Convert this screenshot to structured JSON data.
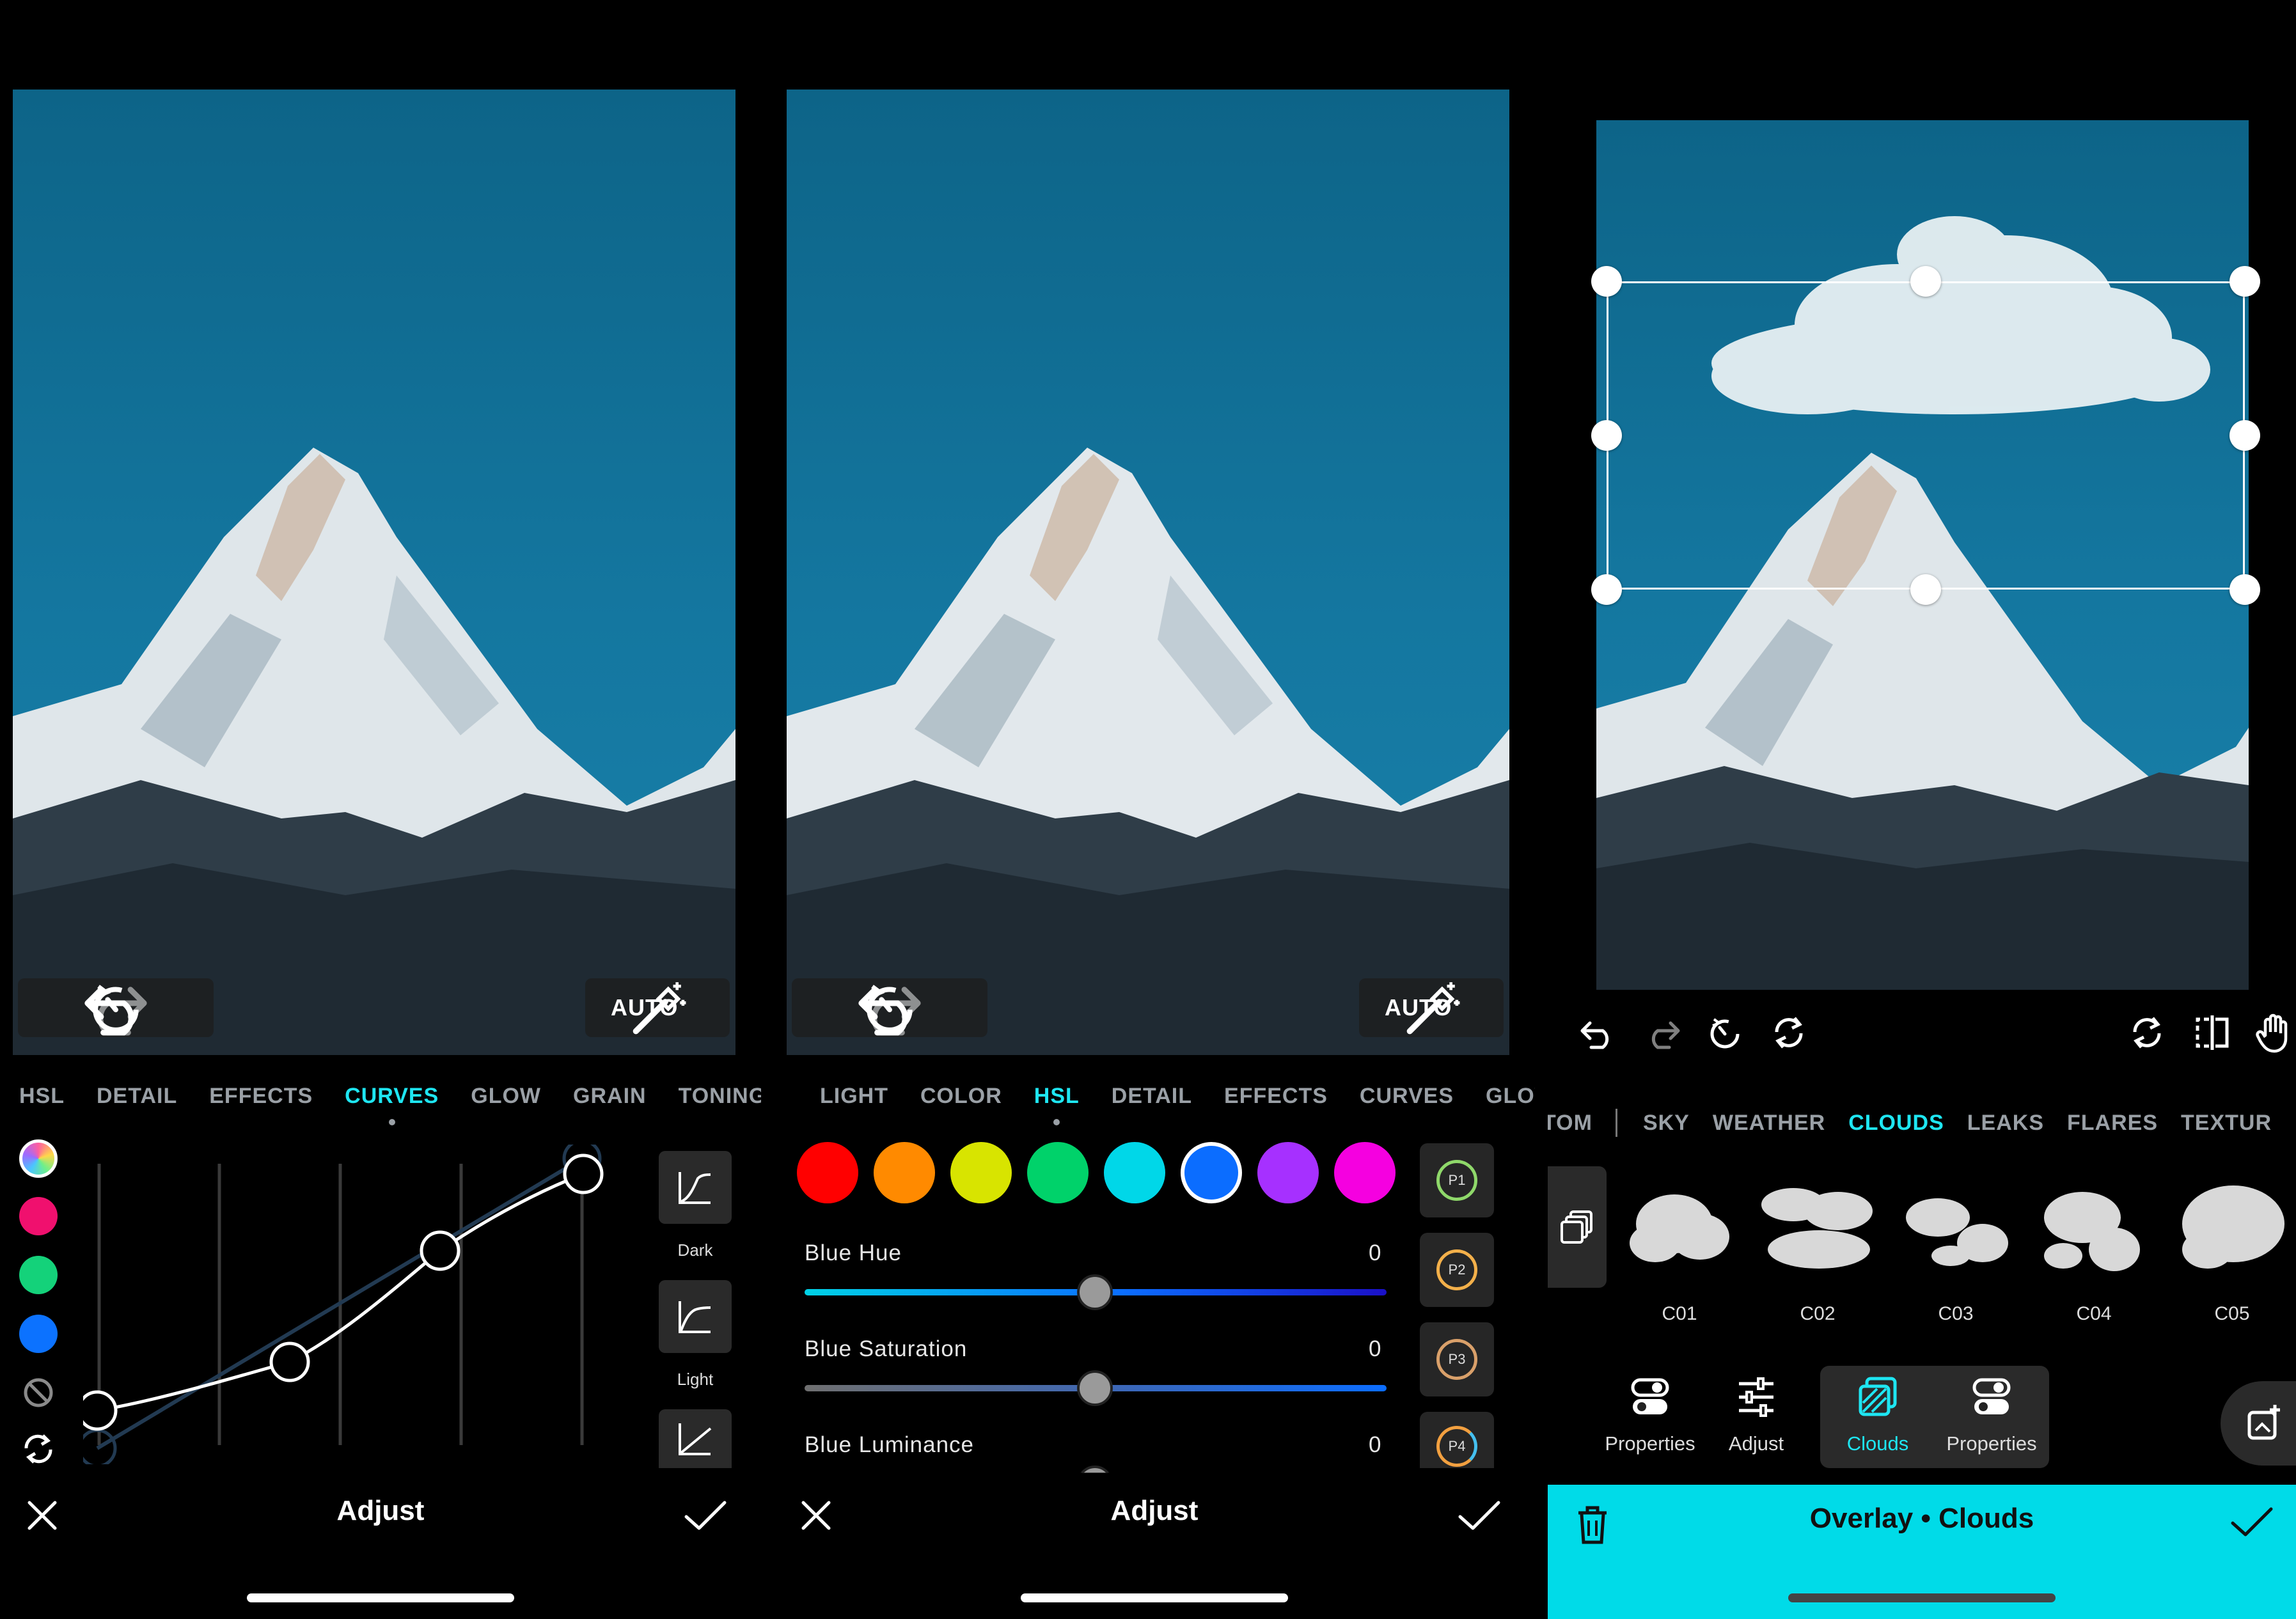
{
  "panel1": {
    "auto_label": "AUTO",
    "tabs": [
      "HSL",
      "DETAIL",
      "EFFECTS",
      "CURVES",
      "GLOW",
      "GRAIN",
      "TONING"
    ],
    "active_tab": "CURVES",
    "presets": [
      {
        "label": "Dark"
      },
      {
        "label": "Light"
      },
      {
        "label": ""
      }
    ],
    "bottom_title": "Adjust"
  },
  "panel2": {
    "auto_label": "AUTO",
    "tabs": [
      "LIGHT",
      "COLOR",
      "HSL",
      "DETAIL",
      "EFFECTS",
      "CURVES",
      "GLOW"
    ],
    "active_tab": "HSL",
    "color_swatches": [
      "#ff0000",
      "#ff8a00",
      "#d8e400",
      "#00d26a",
      "#00d7e8",
      "#0b6dff",
      "#a630ff",
      "#f500e0"
    ],
    "selected_swatch": "#0b6dff",
    "sliders": [
      {
        "label": "Blue Hue",
        "value": "0"
      },
      {
        "label": "Blue Saturation",
        "value": "0"
      },
      {
        "label": "Blue Luminance",
        "value": "0"
      }
    ],
    "preset_chips": [
      "P1",
      "P2",
      "P3",
      "P4"
    ],
    "bottom_title": "Adjust"
  },
  "panel3": {
    "tabs": [
      "TOM",
      "SKY",
      "WEATHER",
      "CLOUDS",
      "LEAKS",
      "FLARES",
      "TEXTUR"
    ],
    "active_tab": "CLOUDS",
    "thumbnails": [
      "C01",
      "C02",
      "C03",
      "C04",
      "C05"
    ],
    "sub_toolbar": [
      "Properties",
      "Adjust",
      "Clouds",
      "Properties"
    ],
    "active_sub": "Clouds",
    "bottom_title": "Overlay • Clouds",
    "accent": "#00dbe8"
  },
  "colors": {
    "accent": "#1ee6f2",
    "background": "#000000",
    "sky": "#1477a0"
  },
  "icons": [
    "undo-icon",
    "redo-icon",
    "reset-history-icon",
    "magic-wand-icon",
    "close-icon",
    "check-icon",
    "color-wheel-icon",
    "no-color-icon",
    "swap-icon",
    "sync-icon",
    "flip-icon",
    "hand-icon",
    "layers-icon",
    "trash-icon",
    "add-layer-icon"
  ]
}
